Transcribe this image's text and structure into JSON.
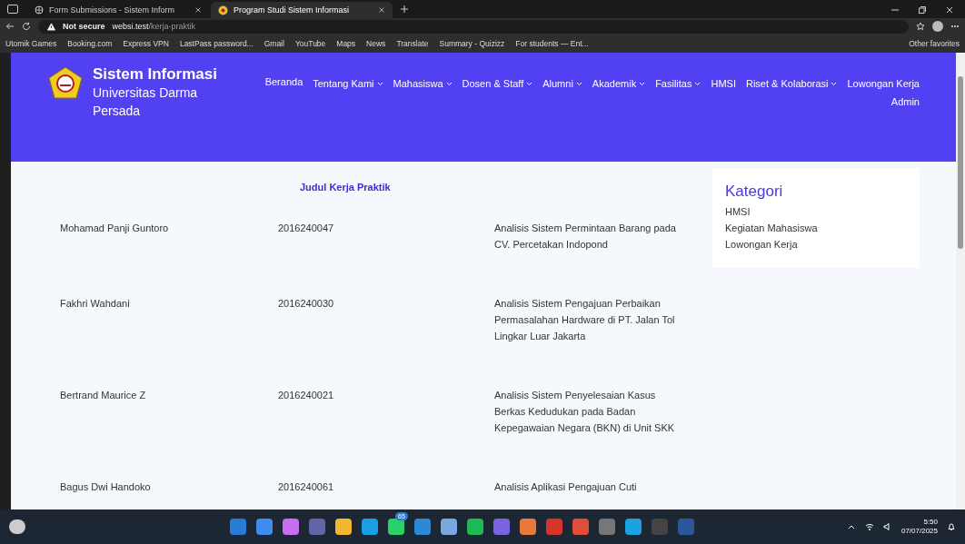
{
  "browser": {
    "tabs": [
      {
        "title": "Form Submissions - Sistem Inform",
        "selected": false
      },
      {
        "title": "Program Studi Sistem Informasi",
        "selected": true
      }
    ],
    "address": {
      "security": "Not secure",
      "host": "websi.test",
      "path": "/kerja-praktik"
    },
    "bookmarks": [
      "Utomik Games",
      "Booking.com",
      "Express VPN",
      "LastPass password...",
      "Gmail",
      "YouTube",
      "Maps",
      "News",
      "Translate",
      "Summary - Quizizz",
      "For students — Ent..."
    ],
    "other_favorites": "Other favorites"
  },
  "header": {
    "title": "Sistem Informasi",
    "subtitle": "Universitas Darma Persada",
    "nav": [
      {
        "label": "Beranda",
        "dropdown": false
      },
      {
        "label": "Tentang Kami",
        "dropdown": true
      },
      {
        "label": "Mahasiswa",
        "dropdown": true
      },
      {
        "label": "Dosen & Staff",
        "dropdown": true
      },
      {
        "label": "Alumni",
        "dropdown": true
      },
      {
        "label": "Akademik",
        "dropdown": true
      },
      {
        "label": "Fasilitas",
        "dropdown": true
      },
      {
        "label": "HMSI",
        "dropdown": false
      },
      {
        "label": "Riset & Kolaborasi",
        "dropdown": true
      },
      {
        "label": "Lowongan Kerja",
        "dropdown": false
      },
      {
        "label": "Admin",
        "dropdown": false
      }
    ]
  },
  "table": {
    "heading": "Judul Kerja Praktik",
    "rows": [
      {
        "name": "Mohamad Panji Guntoro",
        "nim": "2016240047",
        "title": "Analisis Sistem Permintaan Barang pada CV. Percetakan Indopond"
      },
      {
        "name": "Fakhri Wahdani",
        "nim": "2016240030",
        "title": "Analisis Sistem Pengajuan Perbaikan Permasalahan Hardware di PT. Jalan Tol Lingkar Luar Jakarta"
      },
      {
        "name": "Bertrand Maurice Z",
        "nim": "2016240021",
        "title": "Analisis Sistem Penyelesaian Kasus Berkas Kedudukan pada Badan Kepegawaian Negara (BKN) di Unit SKK"
      },
      {
        "name": "Bagus Dwi Handoko",
        "nim": "2016240061",
        "title": "Analisis Aplikasi Pengajuan Cuti"
      }
    ]
  },
  "sidebar": {
    "title": "Kategori",
    "items": [
      "HMSI",
      "Kegiatan Mahasiswa",
      "Lowongan Kerja"
    ]
  },
  "taskbar": {
    "badge": "65",
    "time": "5:50",
    "date": "07/07/2025"
  }
}
